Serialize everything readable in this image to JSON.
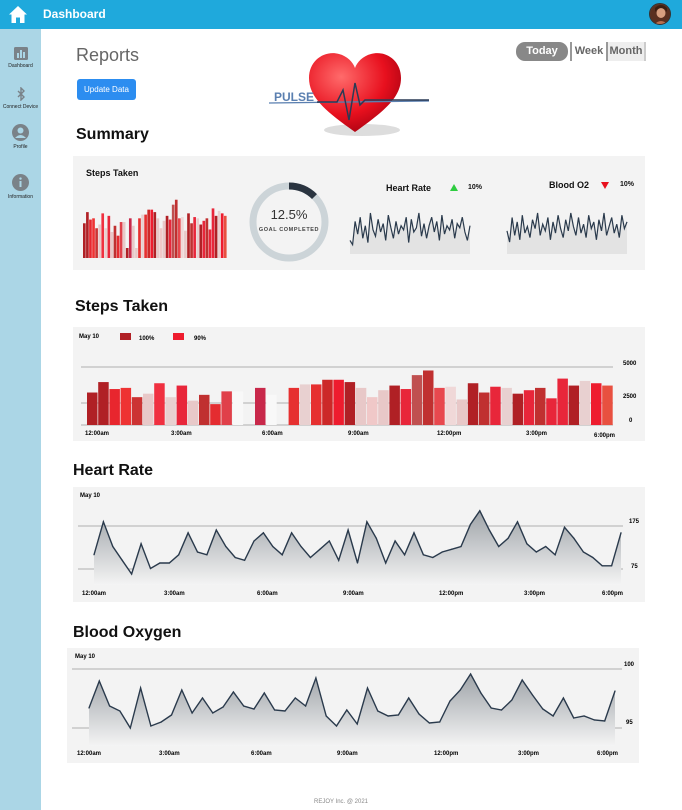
{
  "app": {
    "title": "Dashboard"
  },
  "sidebar": {
    "items": [
      {
        "label": "Dashboard"
      },
      {
        "label": "Connect Device"
      },
      {
        "label": "Profile"
      },
      {
        "label": "Information"
      }
    ]
  },
  "header": {
    "title": "Reports",
    "update_label": "Update Data",
    "logo_text": "PULSE",
    "ranges": [
      "Today",
      "Week",
      "Month"
    ],
    "selected_range": "Today"
  },
  "summary": {
    "title": "Summary",
    "steps_label": "Steps Taken",
    "goal_value": "12.5%",
    "goal_label": "GOAL COMPLETED",
    "goal_fraction": 0.125,
    "heart_label": "Heart Rate",
    "heart_change": "10%",
    "heart_trend": "up",
    "oxygen_label": "Blood O2",
    "oxygen_change": "10%",
    "oxygen_trend": "down"
  },
  "steps": {
    "title": "Steps Taken",
    "date": "May 10",
    "legend": [
      {
        "label": "100%",
        "color": "#b02025"
      },
      {
        "label": "90%",
        "color": "#ee1c2e"
      }
    ],
    "y_ticks": [
      "5000",
      "2500",
      "0"
    ],
    "x_ticks": [
      "12:00am",
      "3:00am",
      "6:00am",
      "9:00am",
      "12:00pm",
      "3:00pm",
      "6:00pm"
    ]
  },
  "heart": {
    "title": "Heart Rate",
    "date": "May 10",
    "y_ticks": [
      "175",
      "75"
    ],
    "x_ticks": [
      "12:00am",
      "3:00am",
      "6:00am",
      "9:00am",
      "12:00pm",
      "3:00pm",
      "6:00pm"
    ]
  },
  "oxygen": {
    "title": "Blood Oxygen",
    "date": "May 10",
    "y_ticks": [
      "100",
      "95"
    ],
    "x_ticks": [
      "12:00am",
      "3:00am",
      "6:00am",
      "9:00am",
      "12:00pm",
      "3:00pm",
      "6:00pm"
    ]
  },
  "footer": "REJOY Inc. @ 2021",
  "colors": {
    "topbar": "#1fa9dc",
    "sidebar": "#abd6e6",
    "button": "#2c8df0",
    "up": "#2ecc40",
    "down": "#e8101e"
  },
  "chart_data": [
    {
      "type": "bar",
      "name": "steps",
      "ylim": [
        0,
        6000
      ],
      "values": [
        2800,
        3700,
        3100,
        3200,
        2400,
        2700,
        3600,
        2400,
        3400,
        2100,
        2600,
        1800,
        2900,
        2900,
        0,
        3200,
        2600,
        0,
        3200,
        3500,
        3500,
        3900,
        3900,
        3700,
        3200,
        2400,
        3000,
        3400,
        3100,
        4300,
        4700,
        3200,
        3300,
        2200,
        3600,
        2800,
        3300,
        3200,
        2700,
        3000,
        3200,
        2300,
        4000,
        3400,
        3800,
        3600,
        3400
      ],
      "colors": [
        "#b02025",
        "#b02025",
        "#e8262e",
        "#e33",
        "#cc3333",
        "#e8c8c8",
        "#f03040",
        "#e8d0d0",
        "#e8263a",
        "#e8c8c8",
        "#c03030",
        "#e42c30",
        "#e0404a",
        "#f8f8f8",
        "#b02025",
        "#c8284a",
        "#f8f8f8",
        "#f8f8f8",
        "#e63030",
        "#e8d0d0",
        "#e63030",
        "#cc2828",
        "#ee1c2e",
        "#b02025",
        "#e8c8c8",
        "#f0c8c8",
        "#e8c8c8",
        "#b02025",
        "#e8263a",
        "#c05050",
        "#c03030",
        "#e8484e",
        "#f0d8d8",
        "#e8c8c8",
        "#b02025",
        "#c03030",
        "#e8263a",
        "#e8d0d0",
        "#b02025",
        "#e8263a",
        "#c03030",
        "#e8263a",
        "#e8263a",
        "#b02025",
        "#e8d0d0",
        "#ee1c2e",
        "#e85040"
      ]
    },
    {
      "type": "area",
      "name": "heart_rate",
      "ylim": [
        40,
        200
      ],
      "values": [
        95,
        155,
        110,
        85,
        60,
        115,
        70,
        80,
        80,
        95,
        135,
        100,
        95,
        140,
        110,
        90,
        85,
        120,
        135,
        110,
        95,
        135,
        110,
        90,
        105,
        120,
        85,
        140,
        80,
        155,
        125,
        80,
        120,
        95,
        135,
        95,
        90,
        100,
        105,
        110,
        150,
        175,
        140,
        110,
        125,
        155,
        115,
        100,
        110,
        95,
        145,
        125,
        100,
        90,
        75,
        75,
        135
      ]
    },
    {
      "type": "area",
      "name": "blood_oxygen",
      "ylim": [
        92,
        101
      ],
      "values": [
        95.8,
        98.5,
        96,
        95.5,
        93.8,
        97.8,
        94,
        94.4,
        95.1,
        97.6,
        95.3,
        96.8,
        95.3,
        95.9,
        97.4,
        96,
        95.7,
        97.3,
        95.6,
        95.5,
        96.8,
        96,
        98.8,
        95,
        94,
        95.6,
        94.2,
        97.8,
        95.5,
        95,
        95.1,
        96.8,
        95.2,
        94.3,
        94.4,
        96.5,
        97.6,
        99.2,
        97.3,
        95.8,
        95.6,
        96.6,
        98.6,
        97.1,
        95.7,
        95,
        96.8,
        94.8,
        95,
        94.6,
        94.5,
        97.5
      ]
    },
    {
      "type": "line",
      "name": "summary_heart",
      "values": [
        5,
        3,
        14,
        8,
        16,
        6,
        12,
        4,
        18,
        10,
        7,
        15,
        9,
        13,
        5,
        17,
        11,
        6,
        14,
        8,
        12,
        10,
        16,
        4,
        15,
        9,
        11,
        18,
        7,
        13,
        6,
        12,
        16,
        9,
        14,
        5,
        17,
        8,
        12,
        10,
        15,
        6,
        13,
        11,
        16,
        9,
        5,
        12
      ]
    },
    {
      "type": "line",
      "name": "summary_oxygen",
      "values": [
        9,
        4,
        15,
        7,
        13,
        5,
        16,
        8,
        11,
        6,
        14,
        10,
        17,
        7,
        12,
        9,
        15,
        5,
        13,
        8,
        16,
        10,
        6,
        14,
        9,
        17,
        11,
        7,
        15,
        8,
        12,
        6,
        16,
        10,
        13,
        5,
        14,
        9,
        17,
        7,
        11,
        15,
        8,
        12,
        6,
        16,
        10,
        13
      ]
    }
  ]
}
